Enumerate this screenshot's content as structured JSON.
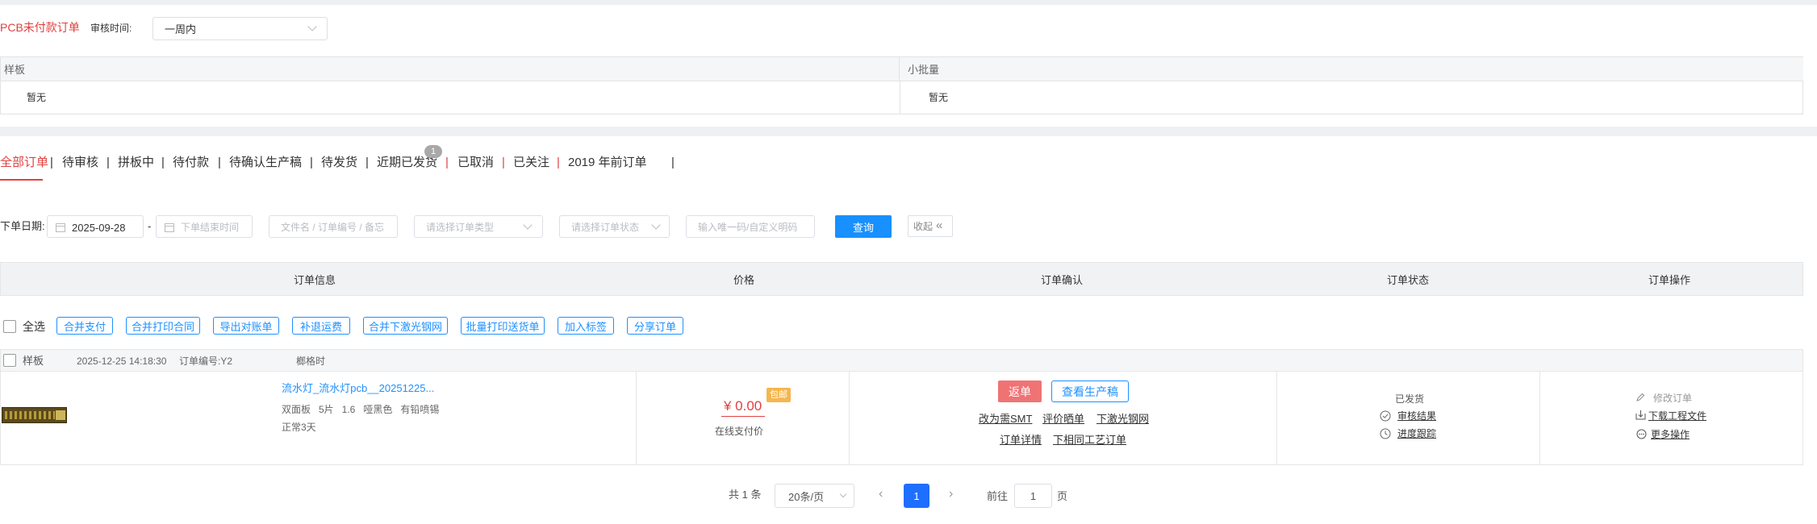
{
  "filter_top": {
    "title": "PCB未付款订单",
    "review_time_label": "审核时间:",
    "review_time_value": "一周内"
  },
  "summary": {
    "left_header": "样板",
    "left_value": "暂无",
    "right_header": "小批量",
    "right_value": "暂无"
  },
  "tabs": [
    {
      "label": "全部订单",
      "active": true
    },
    {
      "label": "待审核"
    },
    {
      "label": "拼板中"
    },
    {
      "label": "待付款"
    },
    {
      "label": "待确认生产稿"
    },
    {
      "label": "待发货"
    },
    {
      "label": "近期已发货",
      "badge": "1"
    },
    {
      "label": "已取消"
    },
    {
      "label": "已关注"
    },
    {
      "label": "2019 年前订单"
    }
  ],
  "search": {
    "date_label": "下单日期:",
    "start_date": "2025-09-28",
    "date_sep": "-",
    "end_placeholder": "下单结束时间",
    "keyword_placeholder": "文件名 / 订单编号 / 备忘",
    "type_placeholder": "请选择订单类型",
    "status_placeholder": "请选择订单状态",
    "code_placeholder": "输入唯一码/自定义明码",
    "query_label": "查询",
    "collapse_label": "收起"
  },
  "table_header": [
    "订单信息",
    "价格",
    "订单确认",
    "订单状态",
    "订单操作"
  ],
  "bulk": {
    "select_all": "全选",
    "buttons": [
      "合并支付",
      "合并打印合同",
      "导出对账单",
      "补退运费",
      "合并下激光钢网",
      "批量打印送货单",
      "加入标签",
      "分享订单"
    ]
  },
  "order": {
    "type": "样板",
    "datetime": "2025-12-25 14:18:30",
    "order_no": "订单编号:Y2",
    "extra": "榔格时",
    "title": "流水灯_流水灯pcb__20251225...",
    "specs": "双面板   5片   1.6   哑黑色   有铅喷锡",
    "delivery": "正常3天",
    "price": "¥ 0.00",
    "free_ship": "包邮",
    "pay_type": "在线支付价",
    "btn_return": "返单",
    "btn_view": "查看生产稿",
    "links_row1": [
      "改为需SMT",
      "评价晒单",
      "下激光钢网"
    ],
    "links_row2": [
      "订单详情",
      "下相同工艺订单"
    ],
    "status": "已发货",
    "status_review": "审核结果",
    "status_progress": "进度跟踪",
    "op_modify": "修改订单",
    "op_download": "下载工程文件",
    "op_more": "更多操作"
  },
  "pagination": {
    "total": "共 1 条",
    "per_page": "20条/页",
    "current": "1",
    "goto_label": "前往",
    "goto_value": "1",
    "goto_suffix": "页"
  },
  "colors": {
    "accent_red": "#e0403f",
    "primary_blue": "#1890ff",
    "return_btn": "#f07374",
    "badge_gray": "#a8a8a8",
    "free_ship_orange": "#f6b64d"
  }
}
